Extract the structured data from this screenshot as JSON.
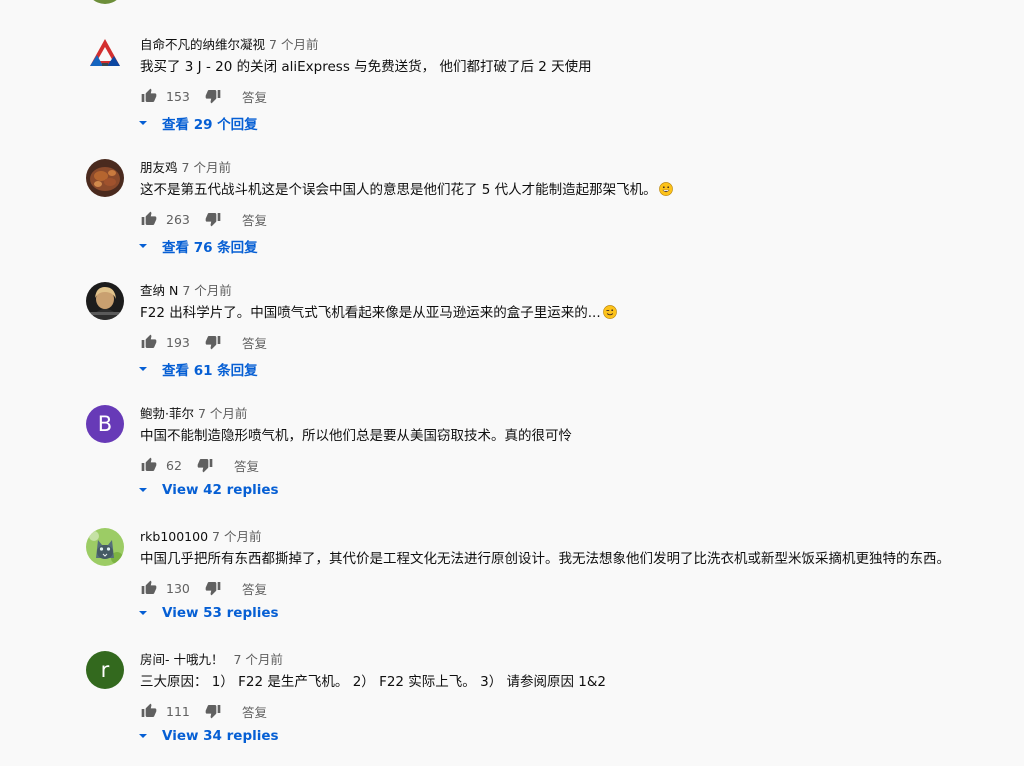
{
  "comments": [
    {
      "author": "自命不凡的纳维尔凝视",
      "time": "7 个月前",
      "text": "我买了 3 J - 20 的关闭 aliExpress 与免费送货， 他们都打破了后 2 天使用",
      "likes": "153",
      "reply_label": "答复",
      "view_replies_label": "查看 29 个回复",
      "avatar": {
        "type": "logo",
        "icon": "triangle-logo-icon"
      }
    },
    {
      "author": "朋友鸡",
      "time": "7 个月前",
      "text": "这不是第五代战斗机这是个误会中国人的意思是他们花了 5 代人才能制造起那架飞机。",
      "emoji": "grinning-face-icon",
      "likes": "263",
      "reply_label": "答复",
      "view_replies_label": "查看 76 条回复",
      "avatar": {
        "type": "photo",
        "icon": "food-photo-avatar"
      }
    },
    {
      "author": "查纳 N",
      "time": "7 个月前",
      "text": "F22 出科学片了。中国喷气式飞机看起来像是从亚马逊运来的盒子里运来的...",
      "emoji": "winking-face-icon",
      "likes": "193",
      "reply_label": "答复",
      "view_replies_label": "查看 61 条回复",
      "avatar": {
        "type": "photo",
        "icon": "person-photo-avatar"
      }
    },
    {
      "author": "鲍勃·菲尔",
      "time": "7 个月前",
      "text": "中国不能制造隐形喷气机，所以他们总是要从美国窃取技术。真的很可怜",
      "likes": "62",
      "reply_label": "答复",
      "view_replies_label": "View 42 replies",
      "avatar": {
        "type": "letter",
        "letter": "B",
        "color": "#673ab7"
      }
    },
    {
      "author": "rkb100100",
      "time": "7 个月前",
      "text": "中国几乎把所有东西都撕掉了，其代价是工程文化无法进行原创设计。我无法想象他们发明了比洗衣机或新型米饭采摘机更独特的东西。",
      "likes": "130",
      "reply_label": "答复",
      "view_replies_label": "View 53 replies",
      "avatar": {
        "type": "photo",
        "icon": "cat-photo-avatar"
      }
    },
    {
      "author": "房间- 十哦九！",
      "time": "7 个月前",
      "text": "三大原因： 1） F22 是生产飞机。 2） F22 实际上飞。 3） 请参阅原因 1&2",
      "likes": "111",
      "reply_label": "答复",
      "view_replies_label": "View 34 replies",
      "avatar": {
        "type": "letter",
        "letter": "r",
        "color": "#33691e"
      }
    }
  ],
  "colors": {
    "link": "#065fd4",
    "secondary_text": "#606060",
    "background": "#f9f9f9"
  }
}
